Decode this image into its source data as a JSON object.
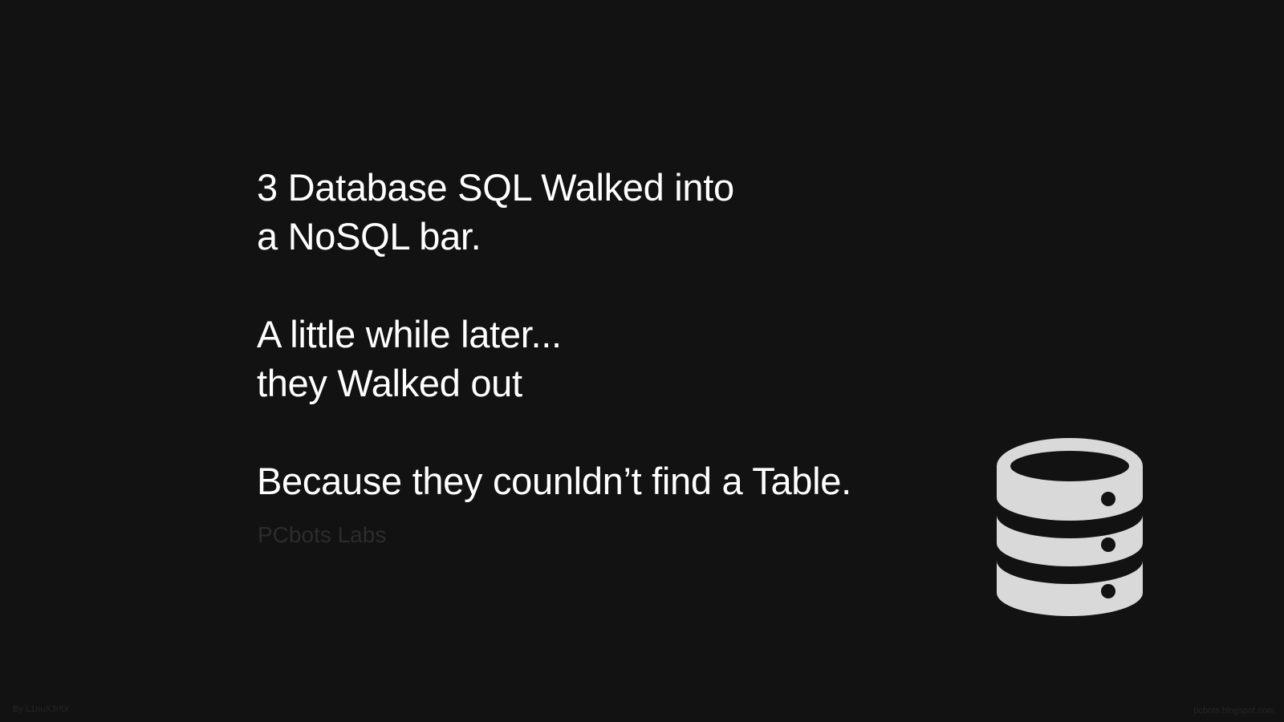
{
  "joke": {
    "line1": "3 Database SQL Walked into",
    "line2": "a NoSQL bar.",
    "line3": "A little while later...",
    "line4": "they Walked out",
    "line5": "Because they counldn’t find a Table."
  },
  "signature": "PCbots Labs",
  "credits": {
    "author": "By L1nuX3r!0r",
    "site": "pcbots.blogspot.com"
  },
  "icon": {
    "name": "database-icon",
    "color": "#d9d9d9"
  },
  "colors": {
    "background": "#121212",
    "text": "#ffffff",
    "muted": "#2c2c2c"
  }
}
